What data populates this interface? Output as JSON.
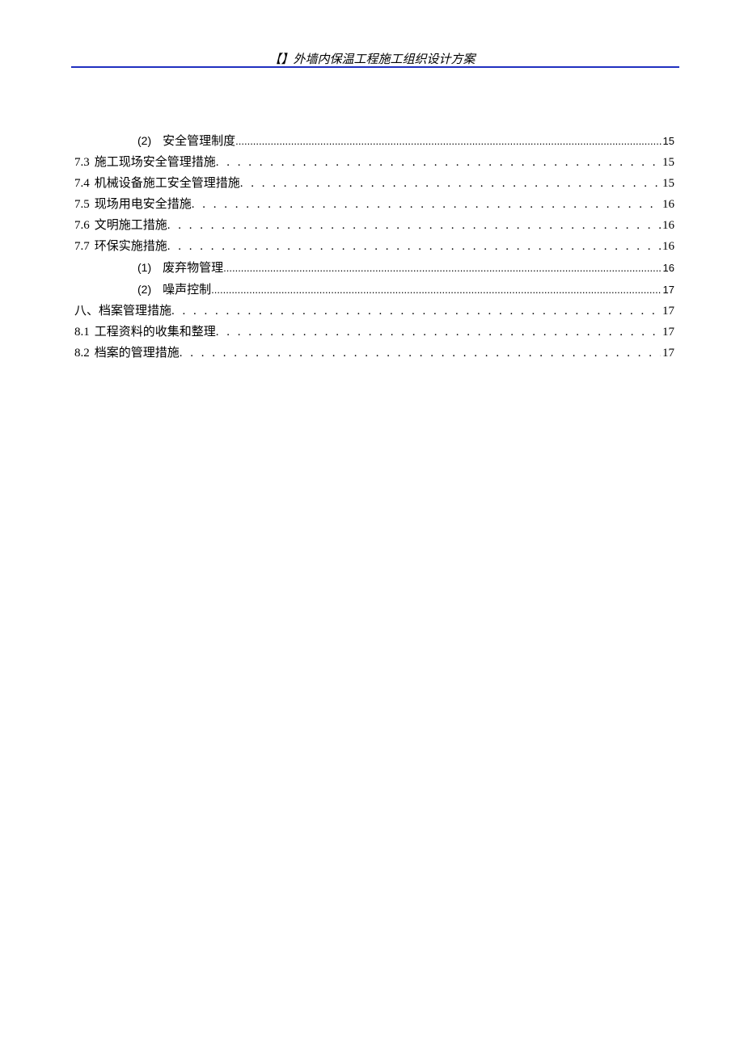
{
  "header": {
    "title": "【】外墙内保温工程施工组织设计方案"
  },
  "toc": [
    {
      "indent": "sub",
      "marker": "(2)",
      "label": "安全管理制度",
      "page": "15",
      "style": "fine"
    },
    {
      "indent": "top",
      "marker": "7.3",
      "label": "施工现场安全管理措施",
      "page": "15",
      "style": "dots"
    },
    {
      "indent": "top",
      "marker": "7.4",
      "label": "机械设备施工安全管理措施",
      "page": "15",
      "style": "dots"
    },
    {
      "indent": "top",
      "marker": "7.5",
      "label": "现场用电安全措施",
      "page": "16",
      "style": "dots"
    },
    {
      "indent": "top",
      "marker": "7.6",
      "label": "文明施工措施",
      "page": "16",
      "style": "dots"
    },
    {
      "indent": "top",
      "marker": "7.7",
      "label": "环保实施措施",
      "page": "16",
      "style": "dots"
    },
    {
      "indent": "sub",
      "marker": "(1)",
      "label": "废弃物管理",
      "page": "16",
      "style": "fine"
    },
    {
      "indent": "sub",
      "marker": "(2)",
      "label": "噪声控制",
      "page": "17",
      "style": "fine"
    },
    {
      "indent": "top",
      "marker": "八、",
      "label": "档案管理措施",
      "page": "17",
      "style": "dots",
      "nogap": true
    },
    {
      "indent": "top",
      "marker": "8.1",
      "label": "工程资料的收集和整理",
      "page": "17",
      "style": "dots"
    },
    {
      "indent": "top",
      "marker": "8.2",
      "label": "档案的管理措施",
      "page": "17",
      "style": "dots"
    }
  ]
}
